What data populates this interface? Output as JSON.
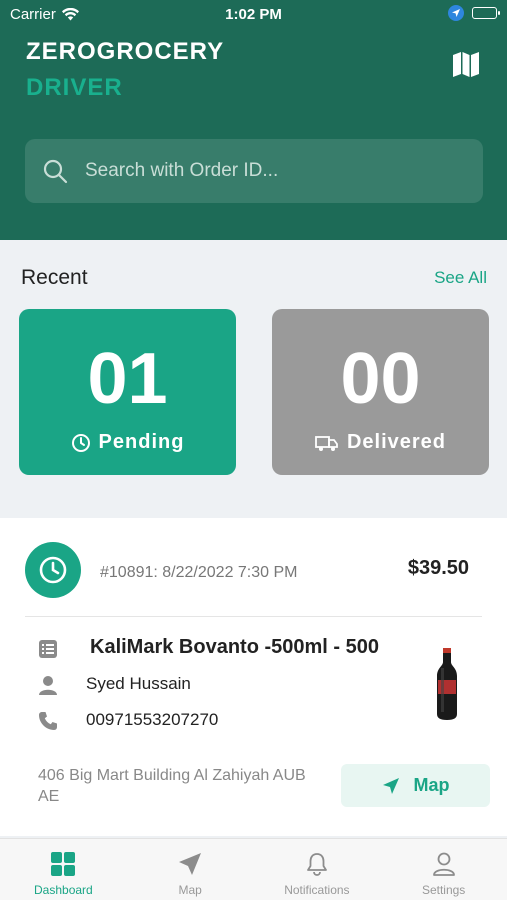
{
  "status_bar": {
    "carrier": "Carrier",
    "time": "1:02 PM"
  },
  "header": {
    "brand": "ZEROGROCERY",
    "brand_sub": "DRIVER",
    "map_icon": "map-icon"
  },
  "search": {
    "placeholder": "Search with Order ID..."
  },
  "recent": {
    "title": "Recent",
    "see_all": "See All",
    "pending": {
      "count": "01",
      "label": "Pending"
    },
    "delivered": {
      "count": "00",
      "label": "Delivered"
    }
  },
  "order": {
    "meta": "#10891: 8/22/2022 7:30 PM",
    "price": "$39.50",
    "product": "KaliMark Bovanto -500ml - 500",
    "customer": "Syed Hussain",
    "phone": "00971553207270",
    "address": "406 Big Mart Building Al Zahiyah AUB AE",
    "map_label": "Map"
  },
  "tabs": [
    {
      "label": "Dashboard",
      "icon": "dashboard-icon",
      "active": true
    },
    {
      "label": "Map",
      "icon": "navigation-icon",
      "active": false
    },
    {
      "label": "Notifications",
      "icon": "bell-icon",
      "active": false
    },
    {
      "label": "Settings",
      "icon": "person-icon",
      "active": false
    }
  ],
  "colors": {
    "header": "#1d6b57",
    "accent": "#1aa586",
    "delivered": "#9a9a9a"
  }
}
